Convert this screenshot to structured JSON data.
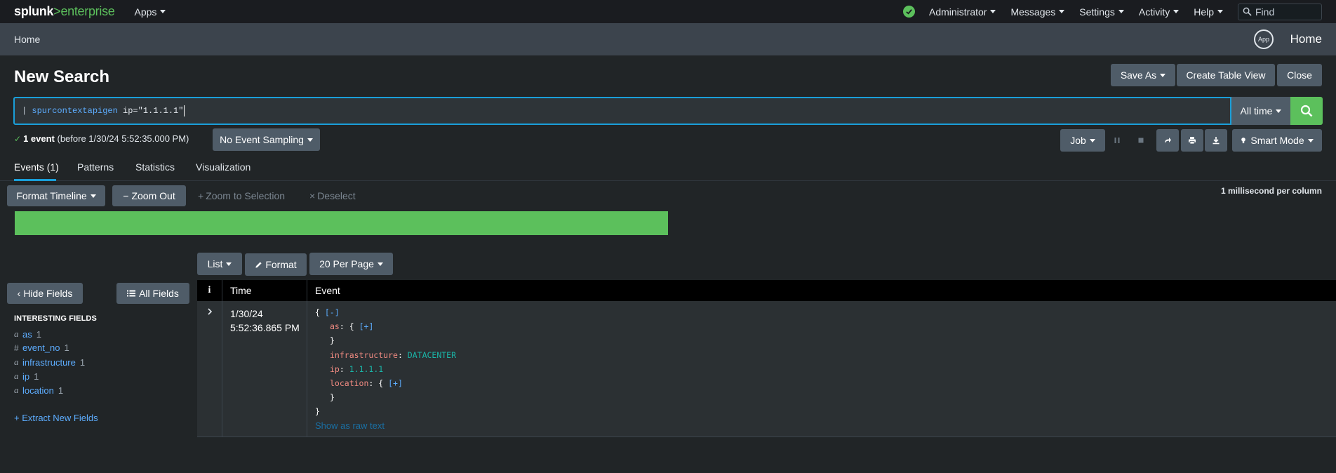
{
  "topbar": {
    "logo_splunk": "splunk",
    "logo_sep": ">",
    "logo_product": "enterprise",
    "apps_label": "Apps",
    "user_label": "Administrator",
    "messages_label": "Messages",
    "settings_label": "Settings",
    "activity_label": "Activity",
    "help_label": "Help",
    "find_placeholder": "Find"
  },
  "appbar": {
    "home_link": "Home",
    "app_badge": "App",
    "app_title": "Home"
  },
  "page": {
    "title": "New Search",
    "save_as": "Save As",
    "create_table_view": "Create Table View",
    "close": "Close"
  },
  "search": {
    "pipe": "|",
    "command": "spurcontextapigen",
    "args": " ip=\"1.1.1.1\"",
    "time_range": "All time"
  },
  "status": {
    "count": "1 event",
    "detail": " (before 1/30/24 5:52:35.000 PM)",
    "sampling": "No Event Sampling",
    "job": "Job",
    "smart_mode": "Smart Mode"
  },
  "tabs": {
    "events": "Events (1)",
    "patterns": "Patterns",
    "statistics": "Statistics",
    "visualization": "Visualization"
  },
  "timeline": {
    "format": "Format Timeline",
    "zoom_out": "Zoom Out",
    "zoom_selection": "Zoom to Selection",
    "deselect": "Deselect",
    "scale": "1 millisecond per column"
  },
  "results": {
    "list": "List",
    "format": "Format",
    "per_page": "20 Per Page"
  },
  "sidebar": {
    "hide_fields": "Hide Fields",
    "all_fields": "All Fields",
    "heading": "INTERESTING FIELDS",
    "fields": [
      {
        "type": "a",
        "name": "as",
        "count": "1"
      },
      {
        "type": "#",
        "name": "event_no",
        "count": "1"
      },
      {
        "type": "a",
        "name": "infrastructure",
        "count": "1"
      },
      {
        "type": "a",
        "name": "ip",
        "count": "1"
      },
      {
        "type": "a",
        "name": "location",
        "count": "1"
      }
    ],
    "extract": "+ Extract New Fields"
  },
  "table": {
    "col_i": "i",
    "col_time": "Time",
    "col_event": "Event",
    "row": {
      "date": "1/30/24",
      "time": "5:52:36.865 PM",
      "open_brace": "{",
      "collapse": "[-]",
      "as_key": "as",
      "expand": "[+]",
      "close_brace": "}",
      "infra_key": "infrastructure",
      "infra_val": "DATACENTER",
      "ip_key": "ip",
      "ip_val": "1.1.1.1",
      "location_key": "location",
      "raw_link": "Show as raw text"
    }
  }
}
